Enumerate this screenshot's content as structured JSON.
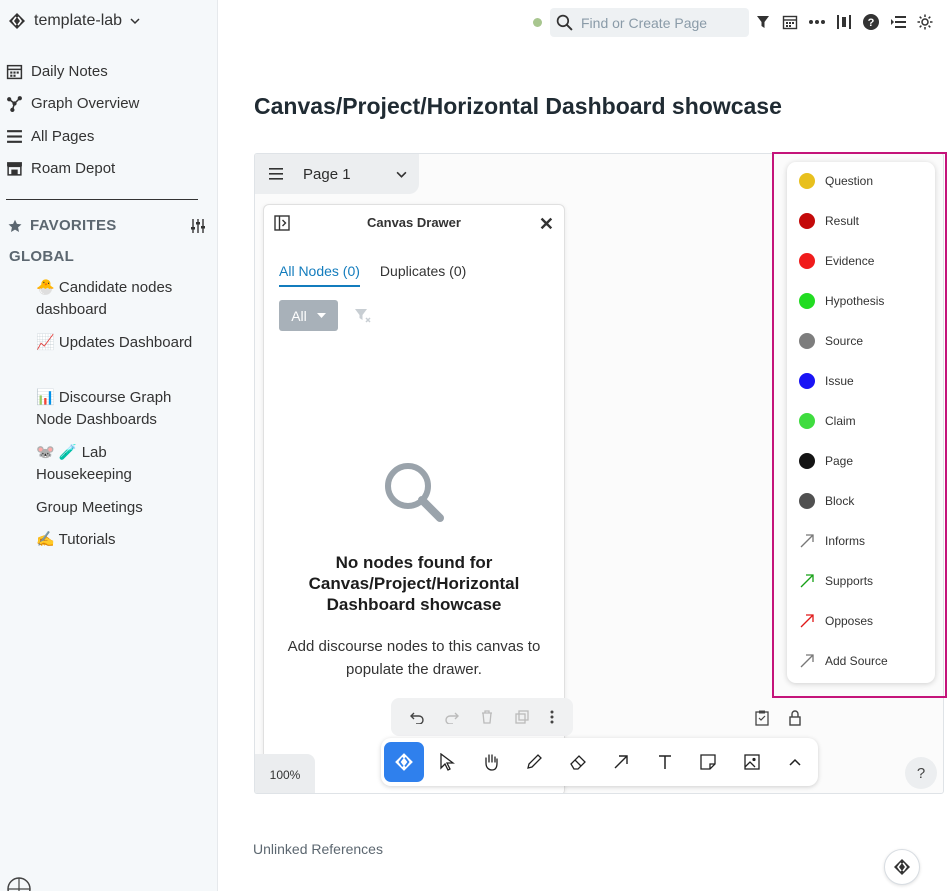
{
  "sidebar": {
    "graph_name": "template-lab",
    "nav": [
      {
        "label": "Daily Notes",
        "icon": "calendar-icon"
      },
      {
        "label": "Graph Overview",
        "icon": "graph-icon"
      },
      {
        "label": "All Pages",
        "icon": "list-icon"
      },
      {
        "label": "Roam Depot",
        "icon": "store-icon"
      }
    ],
    "favorites_label": "FAVORITES",
    "global_label": "GLOBAL",
    "favorites": [
      {
        "emoji": "🐣",
        "label": "Candidate nodes dashboard"
      },
      {
        "emoji": "📈",
        "label": "Updates Dashboard"
      },
      {
        "emoji": "📊",
        "label": "Discourse Graph Node Dashboards"
      },
      {
        "emoji": "🐭 🧪",
        "label": "Lab Housekeeping"
      },
      {
        "emoji": "",
        "label": "Group Meetings"
      },
      {
        "emoji": "✍️",
        "label": "Tutorials"
      }
    ]
  },
  "topbar": {
    "search_placeholder": "Find or Create Page"
  },
  "page": {
    "title": "Canvas/Project/Horizontal Dashboard showcase",
    "unlinked_refs": "Unlinked References"
  },
  "canvas": {
    "page_name": "Page 1",
    "zoom": "100%",
    "help": "?",
    "drawer": {
      "title": "Canvas Drawer",
      "tab_all": "All Nodes (0)",
      "tab_duplicates": "Duplicates (0)",
      "filter": "All",
      "empty_title": "No nodes found for Canvas/Project/Horizontal Dashboard showcase",
      "empty_desc": "Add discourse nodes to this canvas to populate the drawer."
    },
    "node_types": [
      {
        "label": "Question",
        "color": "#e8c01e",
        "kind": "node"
      },
      {
        "label": "Result",
        "color": "#c40a0a",
        "kind": "node"
      },
      {
        "label": "Evidence",
        "color": "#f01c1c",
        "kind": "node"
      },
      {
        "label": "Hypothesis",
        "color": "#22dc22",
        "kind": "node"
      },
      {
        "label": "Source",
        "color": "#7d7d7d",
        "kind": "node"
      },
      {
        "label": "Issue",
        "color": "#1a14f5",
        "kind": "node"
      },
      {
        "label": "Claim",
        "color": "#3fdc3f",
        "kind": "node"
      },
      {
        "label": "Page",
        "color": "#141414",
        "kind": "node"
      },
      {
        "label": "Block",
        "color": "#505050",
        "kind": "node"
      },
      {
        "label": "Informs",
        "color": "#777777",
        "kind": "relation"
      },
      {
        "label": "Supports",
        "color": "#16a016",
        "kind": "relation"
      },
      {
        "label": "Opposes",
        "color": "#e01818",
        "kind": "relation"
      },
      {
        "label": "Add Source",
        "color": "#777777",
        "kind": "relation"
      }
    ],
    "accent_color": "#2f80ed",
    "highlight_color": "#c4147a"
  }
}
